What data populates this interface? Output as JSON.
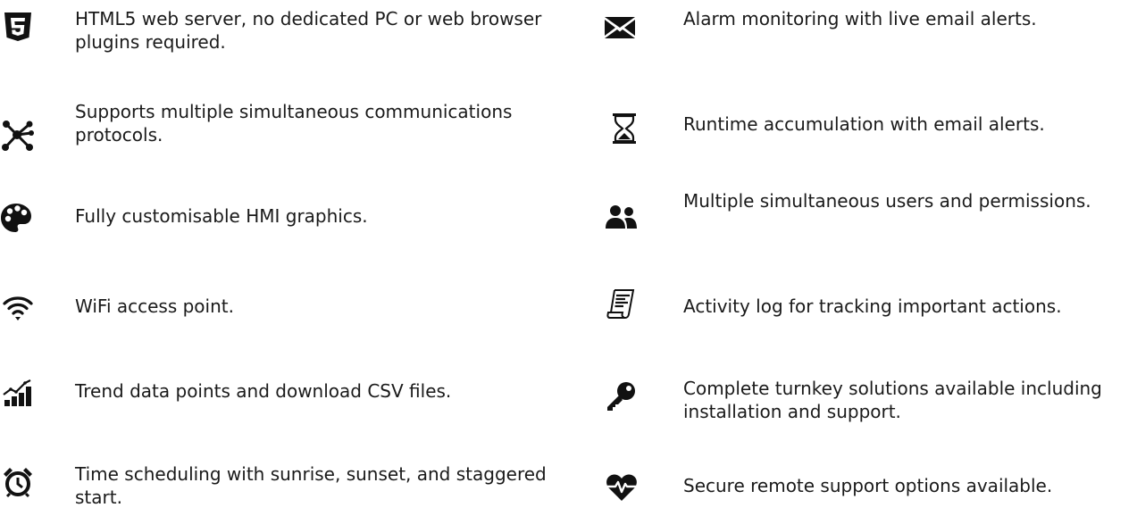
{
  "left_features": [
    {
      "icon": "html5-icon",
      "text": "HTML5 web server, no dedicated PC or web browser plugins required."
    },
    {
      "icon": "network-nodes-icon",
      "text": "Supports multiple simultaneous communications protocols."
    },
    {
      "icon": "palette-icon",
      "text": "Fully customisable HMI graphics."
    },
    {
      "icon": "wifi-icon",
      "text": "WiFi access point."
    },
    {
      "icon": "trend-chart-icon",
      "text": "Trend data points and download CSV files."
    },
    {
      "icon": "alarm-clock-icon",
      "text": "Time scheduling with sunrise, sunset, and staggered start."
    }
  ],
  "right_features": [
    {
      "icon": "envelope-icon",
      "text": "Alarm monitoring with live email alerts."
    },
    {
      "icon": "hourglass-icon",
      "text": "Runtime accumulation with email alerts."
    },
    {
      "icon": "users-icon",
      "text": "Multiple simultaneous users and permissions."
    },
    {
      "icon": "log-scroll-icon",
      "text": "Activity log for tracking important actions."
    },
    {
      "icon": "key-icon",
      "text": "Complete turnkey solutions available including installation and support."
    },
    {
      "icon": "heartbeat-icon",
      "text": "Secure remote support options available."
    }
  ]
}
